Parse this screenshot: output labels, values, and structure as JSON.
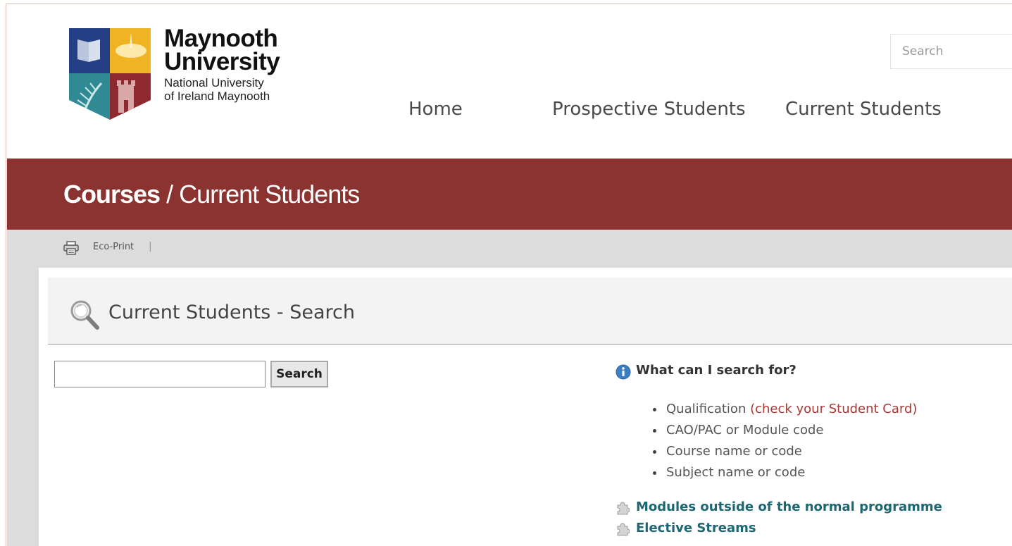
{
  "header": {
    "brand_name_line1": "Maynooth",
    "brand_name_line2": "University",
    "brand_sub_line1": "National University",
    "brand_sub_line2": "of Ireland Maynooth",
    "search_placeholder": "Search",
    "nav": [
      "Home",
      "Prospective Students",
      "Current Students"
    ]
  },
  "banner": {
    "title_bold": "Courses",
    "title_sep": " / ",
    "title_rest": "Current Students",
    "color": "#8b3331"
  },
  "toolbar": {
    "print_label": "Eco-Print",
    "separator": "|"
  },
  "section": {
    "title": "Current Students - Search"
  },
  "course_search": {
    "value": "",
    "button_label": "Search"
  },
  "help": {
    "title": "What can I search for?",
    "items": [
      {
        "text": "Qualification ",
        "note": "(check your Student Card)"
      },
      {
        "text": "CAO/PAC or Module code"
      },
      {
        "text": "Course name or code"
      },
      {
        "text": "Subject name or code"
      }
    ],
    "links": [
      "Modules outside of the normal programme",
      "Elective Streams"
    ],
    "link_color": "#1d6674",
    "note_color": "#a83833"
  },
  "icons": {
    "logo": "maynooth-crest-logo",
    "print": "printer-icon",
    "magnifier": "magnifier-icon",
    "info": "info-icon",
    "puzzle": "puzzle-icon"
  }
}
